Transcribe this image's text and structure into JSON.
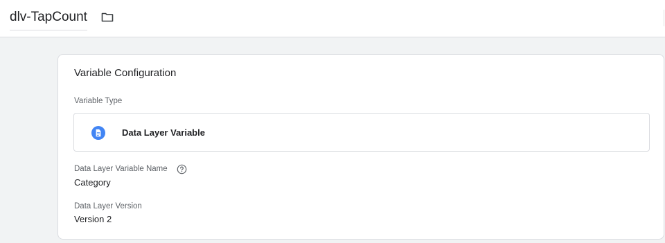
{
  "header": {
    "title": "dlv-TapCount",
    "folder_icon": "folder-icon"
  },
  "card": {
    "title": "Variable Configuration",
    "variable_type_label": "Variable Type",
    "variable_type": {
      "icon": "document-icon",
      "icon_color": "#4285f4",
      "label": "Data Layer Variable"
    },
    "name_field": {
      "label": "Data Layer Variable Name",
      "help_icon": "help-icon",
      "value": "Category"
    },
    "version_field": {
      "label": "Data Layer Version",
      "value": "Version 2"
    }
  }
}
